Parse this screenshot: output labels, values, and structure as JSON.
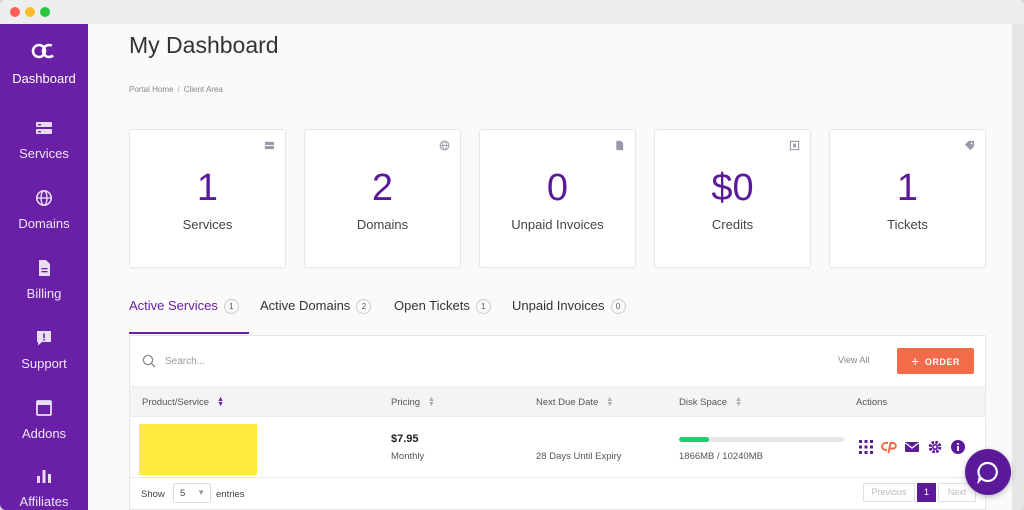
{
  "window": {
    "controls": [
      "close",
      "minimize",
      "maximize"
    ]
  },
  "sidebar": {
    "brand_color": "#6a1fa7",
    "items": [
      {
        "label": "Dashboard",
        "icon": "logo-icon",
        "active": true
      },
      {
        "label": "Services",
        "icon": "server-icon"
      },
      {
        "label": "Domains",
        "icon": "globe-icon"
      },
      {
        "label": "Billing",
        "icon": "document-icon"
      },
      {
        "label": "Support",
        "icon": "chat-alert-icon"
      },
      {
        "label": "Addons",
        "icon": "window-icon"
      },
      {
        "label": "Affiliates",
        "icon": "bar-chart-icon"
      }
    ]
  },
  "header": {
    "title": "My Dashboard",
    "breadcrumb": [
      "Portal Home",
      "Client Area"
    ]
  },
  "stats": [
    {
      "value": "1",
      "label": "Services",
      "icon": "server-icon"
    },
    {
      "value": "2",
      "label": "Domains",
      "icon": "globe-icon"
    },
    {
      "value": "0",
      "label": "Unpaid Invoices",
      "icon": "document-icon"
    },
    {
      "value": "$0",
      "label": "Credits",
      "icon": "credit-icon"
    },
    {
      "value": "1",
      "label": "Tickets",
      "icon": "tag-icon"
    }
  ],
  "tabs": [
    {
      "label": "Active Services",
      "count": "1",
      "active": true
    },
    {
      "label": "Active Domains",
      "count": "2"
    },
    {
      "label": "Open Tickets",
      "count": "1"
    },
    {
      "label": "Unpaid Invoices",
      "count": "0"
    }
  ],
  "toolbar": {
    "search_placeholder": "Search...",
    "view_all": "View All",
    "order_label": "ORDER",
    "order_color": "#f26b4a"
  },
  "table": {
    "columns": [
      "Product/Service",
      "Pricing",
      "Next Due Date",
      "Disk Space",
      "Actions"
    ],
    "sorted_column": "Product/Service",
    "rows": [
      {
        "product_highlight_color": "#ffeb3b",
        "price": "$7.95",
        "cycle": "Monthly",
        "due": "28 Days Until Expiry",
        "disk_used_mb": 1866,
        "disk_total_mb": 10240,
        "disk_text": "1866MB / 10240MB",
        "actions": [
          "grid-icon",
          "cpanel-icon",
          "mail-icon",
          "gear-icon",
          "info-icon"
        ]
      }
    ]
  },
  "footer": {
    "show_label": "Show",
    "page_size": "5",
    "entries_label": "entries",
    "prev_label": "Previous",
    "current_page": "1",
    "next_label": "Next"
  }
}
